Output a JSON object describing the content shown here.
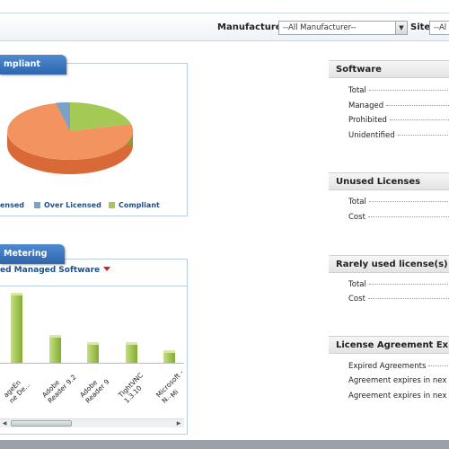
{
  "toolbar": {
    "manufacturer_label": "Manufacturer",
    "manufacturer_value": "--All Manufacturer--",
    "site_label": "Site",
    "site_value": "--Al"
  },
  "compliance": {
    "tab_label": "mpliant",
    "legend": [
      {
        "label": "ensed",
        "color": "#f39360"
      },
      {
        "label": "Over Licensed",
        "color": "#7da0c7"
      },
      {
        "label": "Compliant",
        "color": "#a4c955"
      }
    ],
    "chart_data": {
      "type": "pie",
      "slices": [
        {
          "label": "ensed",
          "value": 78,
          "color": "#f39360"
        },
        {
          "label": "Over Licensed",
          "value": 4,
          "color": "#7da0c7"
        },
        {
          "label": "Compliant",
          "value": 18,
          "color": "#a4c955"
        }
      ]
    }
  },
  "metering": {
    "tab_label": "Metering",
    "dropdown_label": "ed Managed Software",
    "chart_data": {
      "type": "bar",
      "categories": [
        "ageEn\nne De...",
        "Adobe\nReader 9.2",
        "Adobe\nReader 9",
        "TightVNC\n1.3.10",
        "Microsoft -\nN...",
        "Mi"
      ],
      "values": [
        10,
        4,
        3,
        3,
        1.8,
        0
      ],
      "color": "#9cc14c"
    }
  },
  "software": {
    "title": "Software",
    "rows": [
      "Total",
      "Managed",
      "Prohibited",
      "Unidentified"
    ]
  },
  "unused": {
    "title": "Unused Licenses",
    "rows": [
      "Total",
      "Cost"
    ]
  },
  "rarely": {
    "title": "Rarely used license(s)",
    "rows": [
      "Total",
      "Cost"
    ]
  },
  "agreement": {
    "title": "License Agreement Expi",
    "rows": [
      "Expired Agreements",
      "Agreement expires in nex",
      "Agreement expires in nex"
    ]
  }
}
